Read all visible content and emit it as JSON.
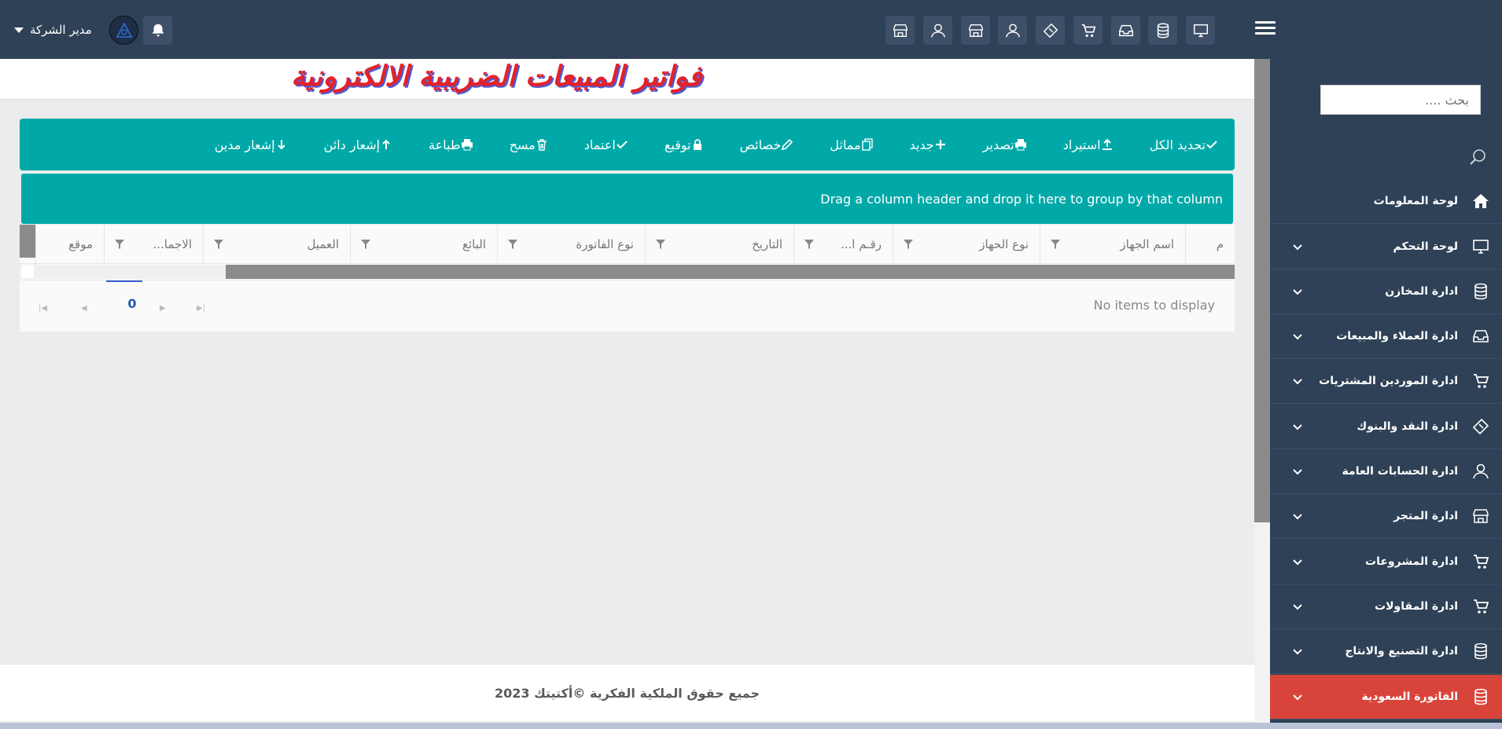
{
  "topbar": {
    "user_label": "مدير الشركة",
    "icons": [
      "store-icon",
      "user-icon",
      "store-icon",
      "user-icon",
      "ticket-icon",
      "cart-icon",
      "inbox-icon",
      "database-icon",
      "monitor-icon"
    ]
  },
  "page": {
    "title": "فواتير المبيعات الضريبية الالكترونية"
  },
  "toolbar": {
    "select_all": "تحديد الكل",
    "import": "استيراد",
    "export": "تصدير",
    "new": "جديد",
    "clone": "مماثل",
    "properties": "خصائص",
    "sign": "توقيع",
    "approve": "اعتماد",
    "delete": "مسح",
    "print": "طباعة",
    "credit_note": "إشعار دائن",
    "debit_note": "إشعار مدين"
  },
  "grid": {
    "group_hint": "Drag a column header and drop it here to group by that column",
    "columns": [
      "م",
      "اسم الجهاز",
      "نوع الحهاز",
      "رقـم ا...",
      "التاريخ",
      "نوع الفاتورة",
      "البائع",
      "العميل",
      "الاجما...",
      "موقع"
    ],
    "page_number": "0",
    "empty_text": "No items to display"
  },
  "footer": {
    "copyright": "جميع حقوق الملكية الفكرية ©أكتيتك 2023"
  },
  "sidebar": {
    "search_placeholder": "بحث ....",
    "items": [
      {
        "label": "لوحة المعلومات",
        "icon": "home-icon"
      },
      {
        "label": "لوحة التحكم",
        "icon": "monitor-icon"
      },
      {
        "label": "ادارة المخازن",
        "icon": "database-icon"
      },
      {
        "label": "ادارة العملاء والمبيعات",
        "icon": "inbox-icon"
      },
      {
        "label": "ادارة الموردين المشتريات",
        "icon": "cart-icon"
      },
      {
        "label": "ادارة النقد والبنوك",
        "icon": "ticket-icon"
      },
      {
        "label": "ادارة الحسابات العامة",
        "icon": "user-icon"
      },
      {
        "label": "ادارة المتجر",
        "icon": "store-icon"
      },
      {
        "label": "ادارة المشروعات",
        "icon": "cart-icon"
      },
      {
        "label": "ادارة المقاولات",
        "icon": "cart-icon"
      },
      {
        "label": "ادارة التصنيع والانتاج",
        "icon": "database-icon"
      },
      {
        "label": "الفاتورة السعودية",
        "icon": "database-icon"
      }
    ]
  },
  "colors": {
    "navy": "#2e4156",
    "teal": "#00a9a8",
    "active": "#d9443a",
    "title_red": "#e52129"
  }
}
